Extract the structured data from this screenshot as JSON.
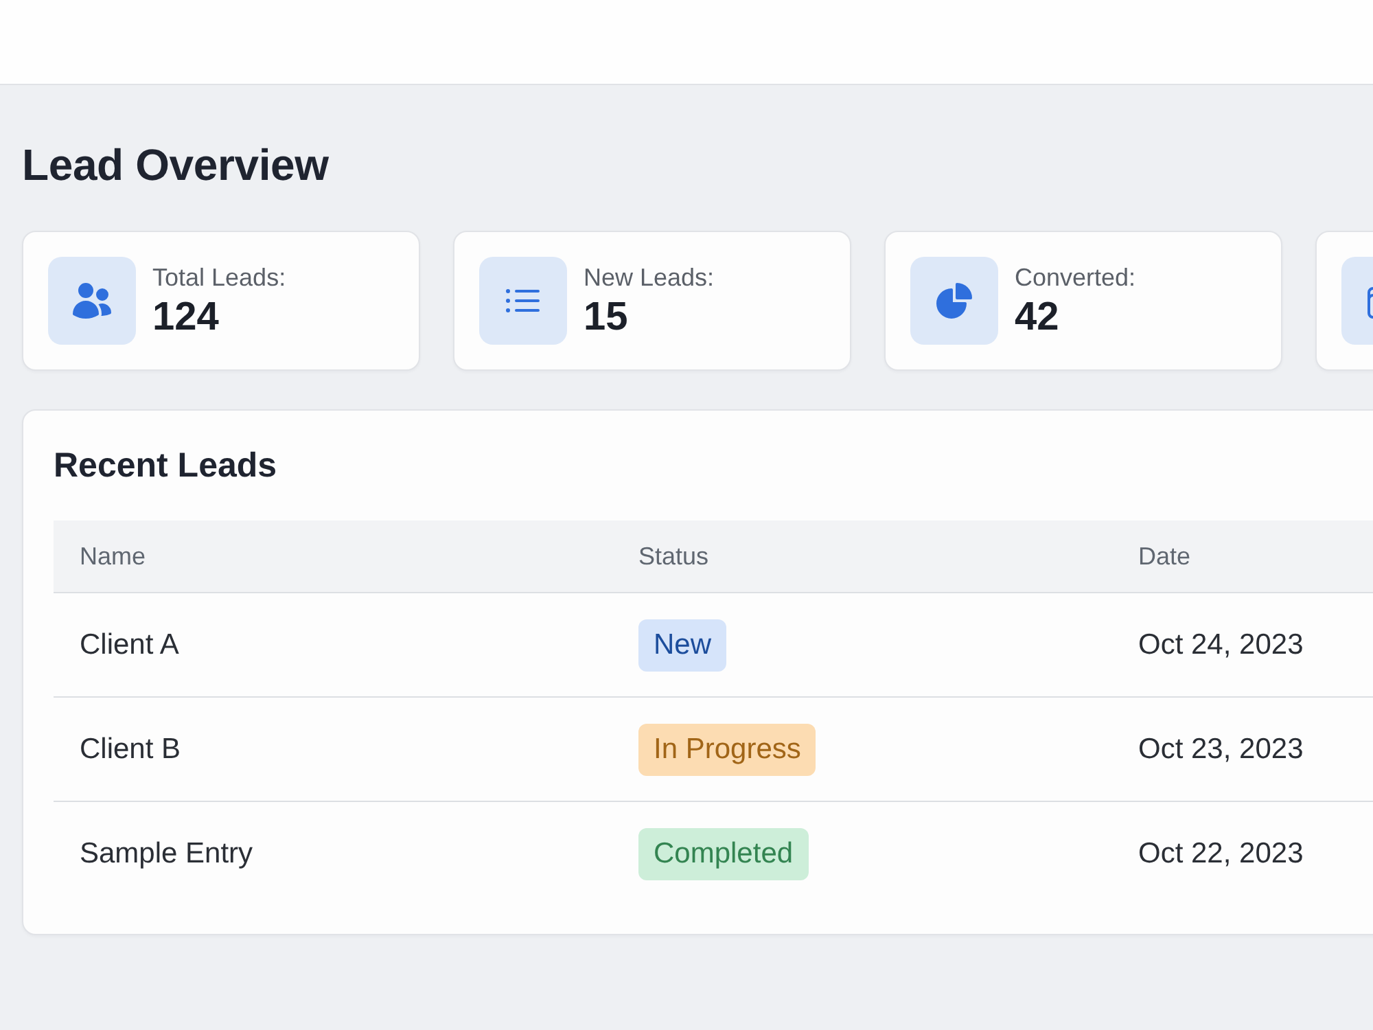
{
  "page": {
    "title": "Lead Overview"
  },
  "stats": [
    {
      "kind": "metric",
      "label": "Total Leads:",
      "value": "124"
    },
    {
      "kind": "metric",
      "label": "New Leads:",
      "value": "15"
    },
    {
      "kind": "metric",
      "label": "Converted:",
      "value": "42"
    },
    {
      "kind": "icon_only"
    }
  ],
  "recent_leads": {
    "title": "Recent Leads",
    "columns": [
      "Name",
      "Status",
      "Date"
    ],
    "rows": [
      {
        "name": "Client A",
        "status": {
          "label": "New",
          "color": "#d6e4fa"
        },
        "date": "Oct 24, 2023"
      },
      {
        "name": "Client B",
        "status": {
          "label": "In Progress",
          "color": "#fcdcb2"
        },
        "date": "Oct 23, 2023"
      },
      {
        "name": "Sample Entry",
        "status": {
          "label": "Completed",
          "color": "#cdeed9"
        },
        "date": "Oct 22, 2023"
      }
    ]
  }
}
